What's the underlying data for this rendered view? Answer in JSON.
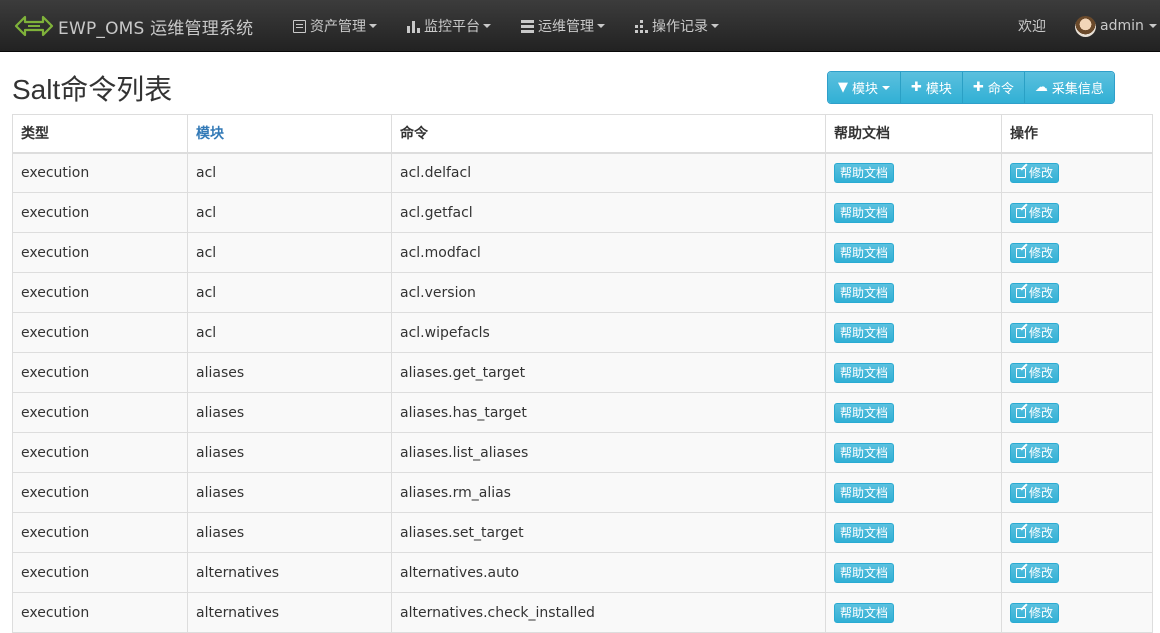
{
  "navbar": {
    "brand": "EWP_OMS 运维管理系统",
    "menus": [
      {
        "label": "资产管理",
        "icon": "list-icon"
      },
      {
        "label": "监控平台",
        "icon": "bar-chart-icon"
      },
      {
        "label": "运维管理",
        "icon": "server-icon"
      },
      {
        "label": "操作记录",
        "icon": "grid-icon"
      }
    ],
    "welcome": "欢迎",
    "username": "admin"
  },
  "page": {
    "title": "Salt命令列表"
  },
  "toolbar": {
    "filter_module": "模块",
    "add_module": "模块",
    "add_command": "命令",
    "collect_info": "采集信息"
  },
  "table": {
    "headers": {
      "type": "类型",
      "module": "模块",
      "command": "命令",
      "help": "帮助文档",
      "op": "操作"
    },
    "help_button": "帮助文档",
    "edit_button": "修改",
    "rows": [
      {
        "type": "execution",
        "module": "acl",
        "command": "acl.delfacl"
      },
      {
        "type": "execution",
        "module": "acl",
        "command": "acl.getfacl"
      },
      {
        "type": "execution",
        "module": "acl",
        "command": "acl.modfacl"
      },
      {
        "type": "execution",
        "module": "acl",
        "command": "acl.version"
      },
      {
        "type": "execution",
        "module": "acl",
        "command": "acl.wipefacls"
      },
      {
        "type": "execution",
        "module": "aliases",
        "command": "aliases.get_target"
      },
      {
        "type": "execution",
        "module": "aliases",
        "command": "aliases.has_target"
      },
      {
        "type": "execution",
        "module": "aliases",
        "command": "aliases.list_aliases"
      },
      {
        "type": "execution",
        "module": "aliases",
        "command": "aliases.rm_alias"
      },
      {
        "type": "execution",
        "module": "aliases",
        "command": "aliases.set_target"
      },
      {
        "type": "execution",
        "module": "alternatives",
        "command": "alternatives.auto"
      },
      {
        "type": "execution",
        "module": "alternatives",
        "command": "alternatives.check_installed"
      }
    ]
  }
}
